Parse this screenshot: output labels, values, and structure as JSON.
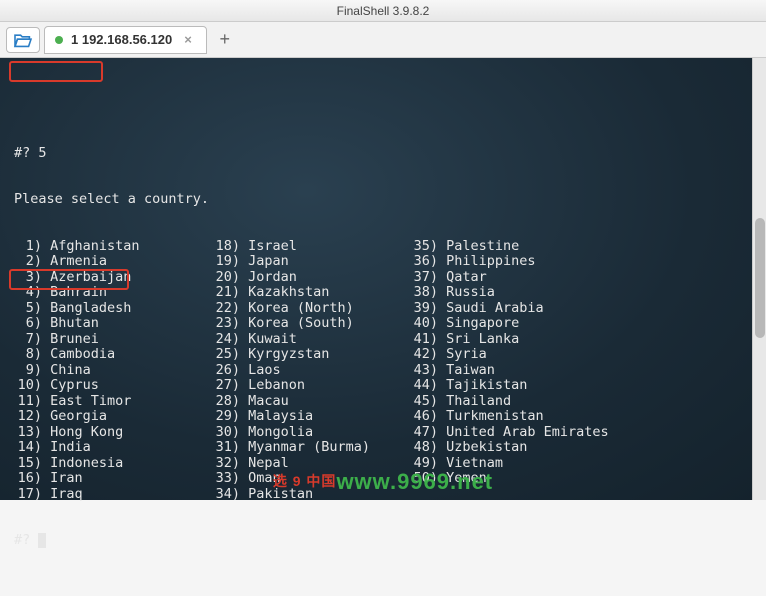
{
  "window": {
    "title": "FinalShell 3.9.8.2"
  },
  "tab": {
    "label": "1 192.168.56.120"
  },
  "terminal": {
    "prompt1": "#? 5",
    "heading": "Please select a country.",
    "col1": [
      {
        "n": "1",
        "t": "Afghanistan"
      },
      {
        "n": "2",
        "t": "Armenia"
      },
      {
        "n": "3",
        "t": "Azerbaijan"
      },
      {
        "n": "4",
        "t": "Bahrain"
      },
      {
        "n": "5",
        "t": "Bangladesh"
      },
      {
        "n": "6",
        "t": "Bhutan"
      },
      {
        "n": "7",
        "t": "Brunei"
      },
      {
        "n": "8",
        "t": "Cambodia"
      },
      {
        "n": "9",
        "t": "China"
      },
      {
        "n": "10",
        "t": "Cyprus"
      },
      {
        "n": "11",
        "t": "East Timor"
      },
      {
        "n": "12",
        "t": "Georgia"
      },
      {
        "n": "13",
        "t": "Hong Kong"
      },
      {
        "n": "14",
        "t": "India"
      },
      {
        "n": "15",
        "t": "Indonesia"
      },
      {
        "n": "16",
        "t": "Iran"
      },
      {
        "n": "17",
        "t": "Iraq"
      }
    ],
    "col2": [
      {
        "n": "18",
        "t": "Israel"
      },
      {
        "n": "19",
        "t": "Japan"
      },
      {
        "n": "20",
        "t": "Jordan"
      },
      {
        "n": "21",
        "t": "Kazakhstan"
      },
      {
        "n": "22",
        "t": "Korea (North)"
      },
      {
        "n": "23",
        "t": "Korea (South)"
      },
      {
        "n": "24",
        "t": "Kuwait"
      },
      {
        "n": "25",
        "t": "Kyrgyzstan"
      },
      {
        "n": "26",
        "t": "Laos"
      },
      {
        "n": "27",
        "t": "Lebanon"
      },
      {
        "n": "28",
        "t": "Macau"
      },
      {
        "n": "29",
        "t": "Malaysia"
      },
      {
        "n": "30",
        "t": "Mongolia"
      },
      {
        "n": "31",
        "t": "Myanmar (Burma)"
      },
      {
        "n": "32",
        "t": "Nepal"
      },
      {
        "n": "33",
        "t": "Oman"
      },
      {
        "n": "34",
        "t": "Pakistan"
      }
    ],
    "col3": [
      {
        "n": "35",
        "t": "Palestine"
      },
      {
        "n": "36",
        "t": "Philippines"
      },
      {
        "n": "37",
        "t": "Qatar"
      },
      {
        "n": "38",
        "t": "Russia"
      },
      {
        "n": "39",
        "t": "Saudi Arabia"
      },
      {
        "n": "40",
        "t": "Singapore"
      },
      {
        "n": "41",
        "t": "Sri Lanka"
      },
      {
        "n": "42",
        "t": "Syria"
      },
      {
        "n": "43",
        "t": "Taiwan"
      },
      {
        "n": "44",
        "t": "Tajikistan"
      },
      {
        "n": "45",
        "t": "Thailand"
      },
      {
        "n": "46",
        "t": "Turkmenistan"
      },
      {
        "n": "47",
        "t": "United Arab Emirates"
      },
      {
        "n": "48",
        "t": "Uzbekistan"
      },
      {
        "n": "49",
        "t": "Vietnam"
      },
      {
        "n": "50",
        "t": "Yemen"
      },
      {
        "n": "",
        "t": ""
      }
    ],
    "prompt2": "#? "
  },
  "annotation": {
    "red_text": "选 9 中国"
  },
  "watermark": {
    "text": "www.9969.net"
  }
}
